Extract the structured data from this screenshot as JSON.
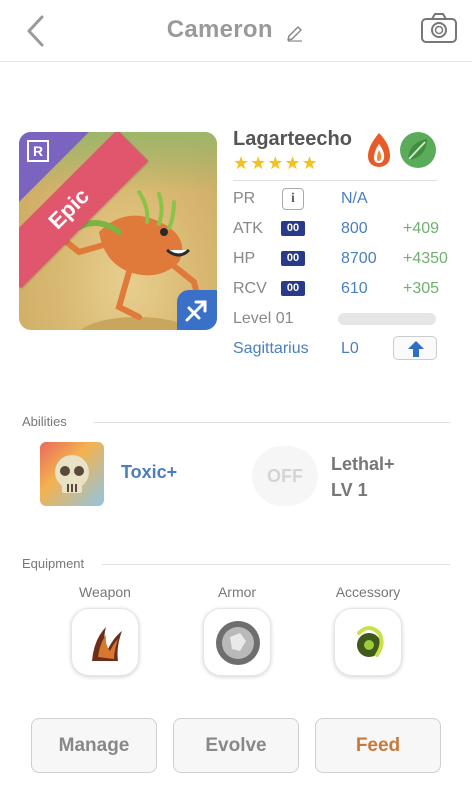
{
  "header": {
    "title": "Cameron"
  },
  "creature": {
    "name": "Lagarteecho",
    "rarity": "Epic",
    "rarity_letter": "R",
    "stars": "★★★★★",
    "elements": [
      "fire-icon",
      "leaf-icon"
    ]
  },
  "stats": {
    "pr": {
      "label": "PR",
      "value": "N/A",
      "info": "i"
    },
    "atk": {
      "label": "ATK",
      "tag": "00",
      "value": "800",
      "bonus": "+409"
    },
    "hp": {
      "label": "HP",
      "tag": "00",
      "value": "8700",
      "bonus": "+4350"
    },
    "rcv": {
      "label": "RCV",
      "tag": "00",
      "value": "610",
      "bonus": "+305"
    },
    "level": {
      "label": "Level 01",
      "xp_progress": 0.0
    },
    "sign": {
      "name": "Sagittarius",
      "level": "L0"
    }
  },
  "abilities": {
    "heading": "Abilities",
    "items": [
      {
        "name": "Toxic+",
        "color": "#4a7fbf"
      },
      {
        "name": "Lethal+",
        "level": "LV 1",
        "status": "OFF",
        "color": "#777777"
      }
    ]
  },
  "equipment": {
    "heading": "Equipment",
    "slots": [
      {
        "label": "Weapon"
      },
      {
        "label": "Armor"
      },
      {
        "label": "Accessory"
      }
    ]
  },
  "actions": {
    "manage": "Manage",
    "evolve": "Evolve",
    "feed": "Feed",
    "feed_color": "#c87a3c"
  }
}
